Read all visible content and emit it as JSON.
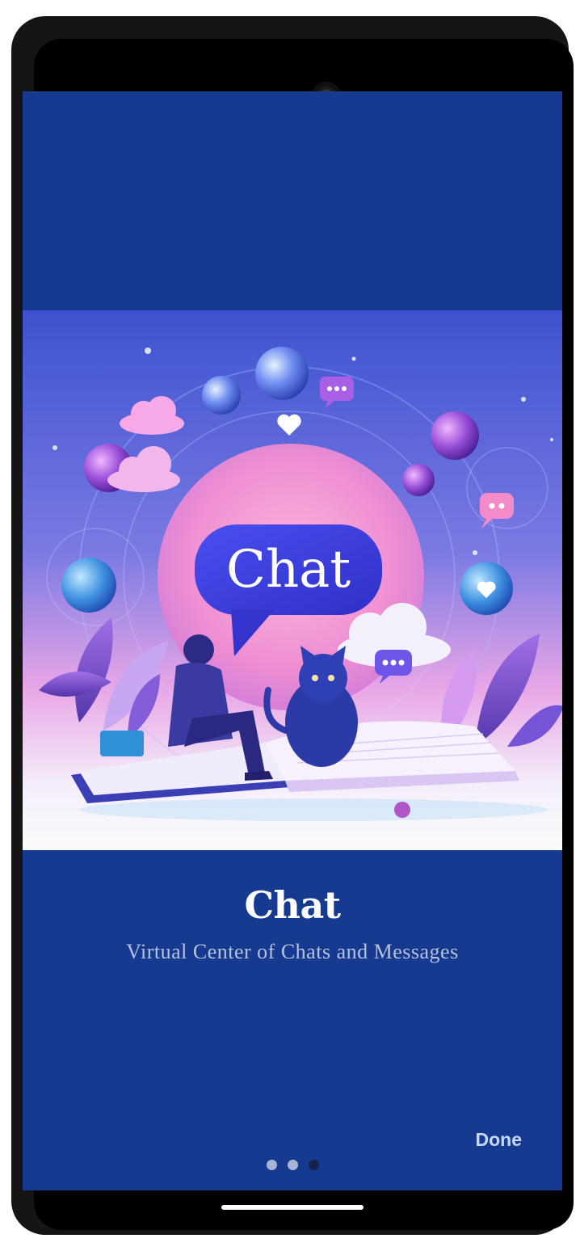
{
  "onboarding": {
    "hero_text": "Chat",
    "title": "Chat",
    "subtitle": "Virtual Center of Chats and Messages",
    "done_label": "Done",
    "page_indicator": {
      "total": 3,
      "active": 3
    }
  },
  "colors": {
    "background": "#153a8f",
    "title": "#ffffff",
    "subtitle": "#b7c3de",
    "done": "#c8d8ff",
    "dot_inactive": "#a8b4d6",
    "dot_active": "#16234f"
  }
}
